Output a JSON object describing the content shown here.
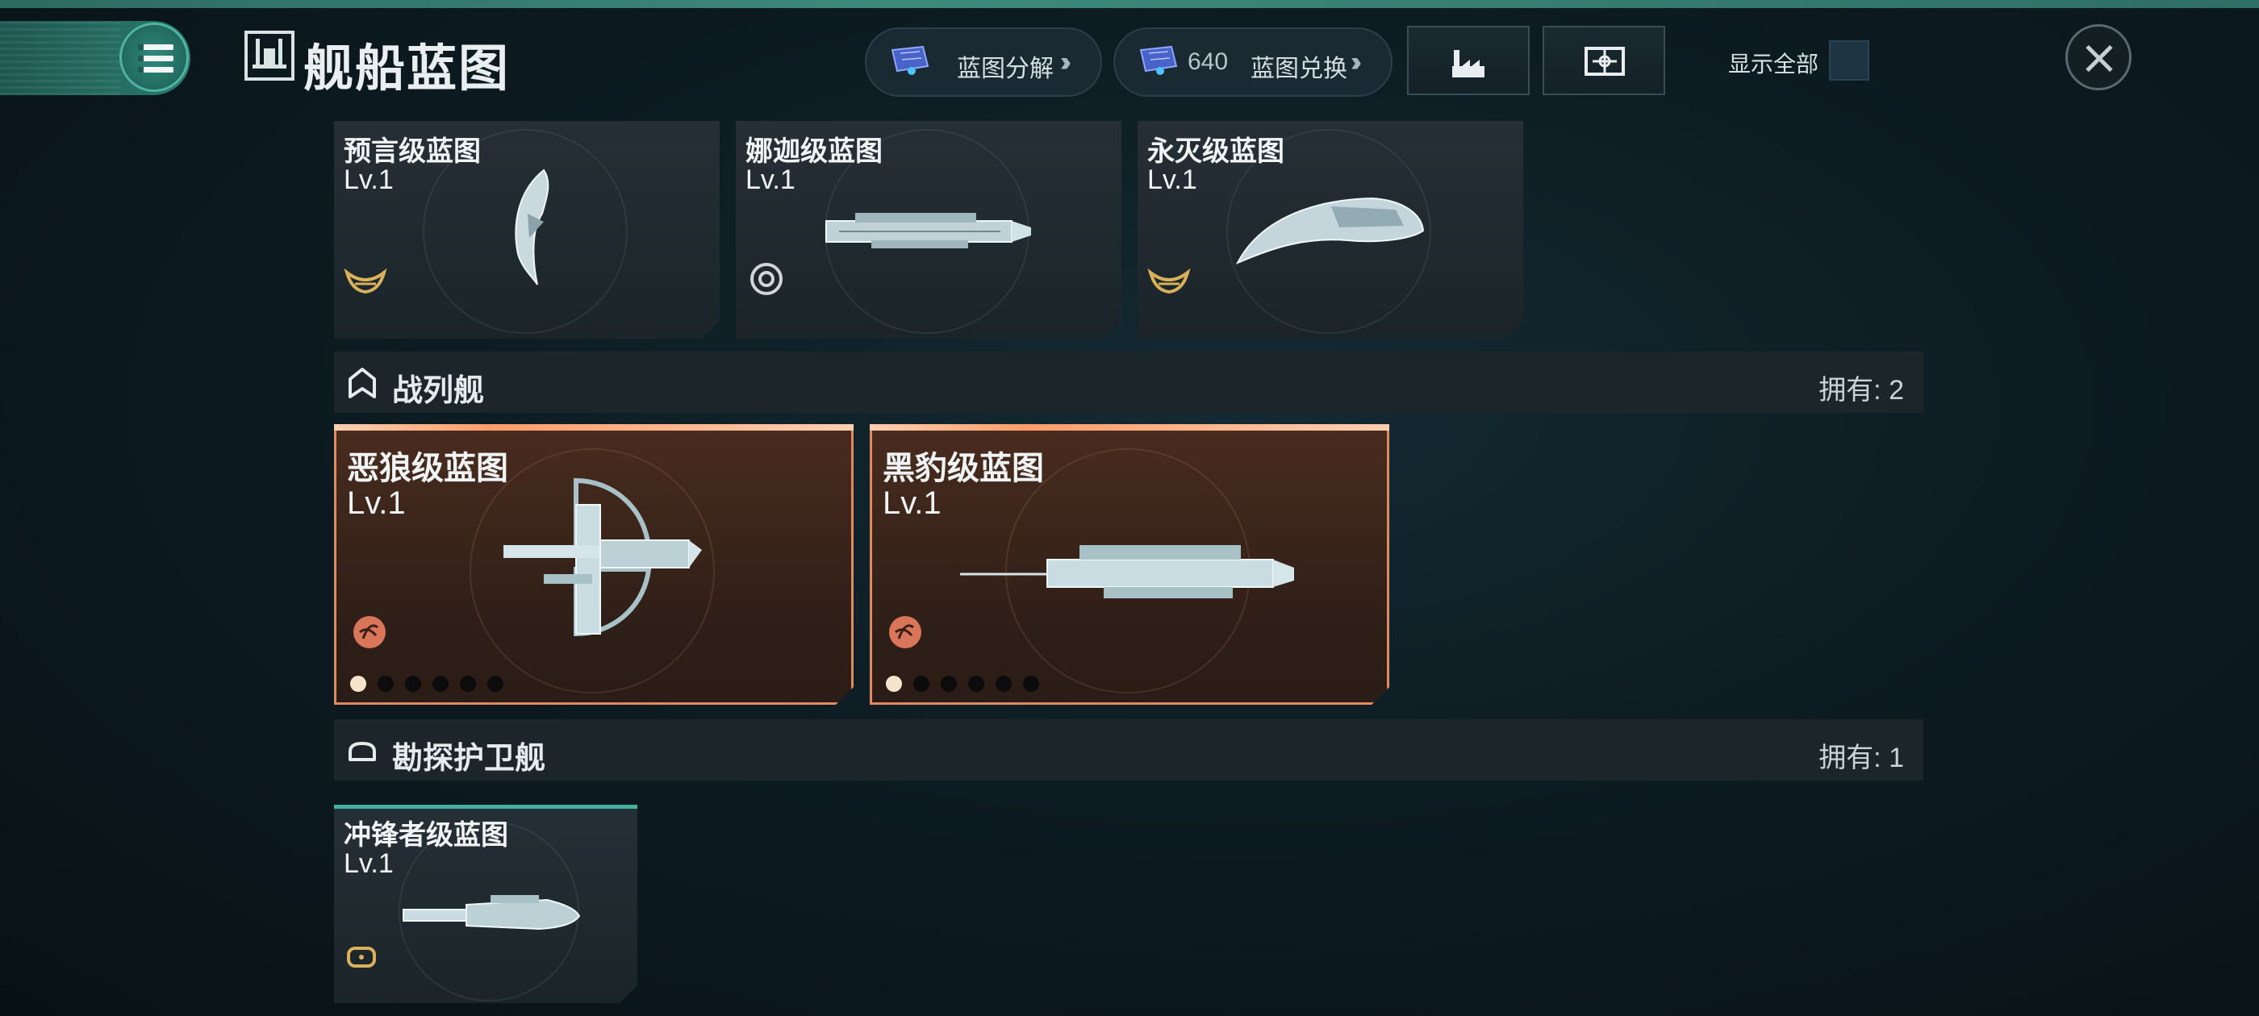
{
  "header": {
    "title": "舰船蓝图",
    "decompose_label": "蓝图分解",
    "exchange_count": "640",
    "exchange_label": "蓝图兑换",
    "show_all_label": "显示全部",
    "chevrons": "»"
  },
  "top_row": [
    {
      "name": "预言级蓝图",
      "level": "Lv.1",
      "badge_icon": "horned-emblem-icon",
      "badge_color": "#d9b15a"
    },
    {
      "name": "娜迦级蓝图",
      "level": "Lv.1",
      "badge_icon": "target-emblem-icon",
      "badge_color": "#cfd6da"
    },
    {
      "name": "永灭级蓝图",
      "level": "Lv.1",
      "badge_icon": "horned-emblem-icon",
      "badge_color": "#d9b15a"
    }
  ],
  "sections": [
    {
      "title": "战列舰",
      "count_label": "拥有: 2",
      "icon": "house-outline-icon",
      "cards": [
        {
          "name": "恶狼级蓝图",
          "level": "Lv.1",
          "badge_icon": "red-faction-icon",
          "stars_on": 1,
          "stars_total": 6
        },
        {
          "name": "黑豹级蓝图",
          "level": "Lv.1",
          "badge_icon": "red-faction-icon",
          "stars_on": 1,
          "stars_total": 6
        }
      ]
    },
    {
      "title": "勘探护卫舰",
      "count_label": "拥有: 1",
      "icon": "dome-outline-icon",
      "cards": [
        {
          "name": "冲锋者级蓝图",
          "level": "Lv.1",
          "badge_icon": "gold-frame-icon"
        }
      ]
    }
  ],
  "colors": {
    "accent_teal": "#2a7a6e",
    "rare_orange": "#e08a62",
    "gold_badge": "#d9b15a"
  }
}
